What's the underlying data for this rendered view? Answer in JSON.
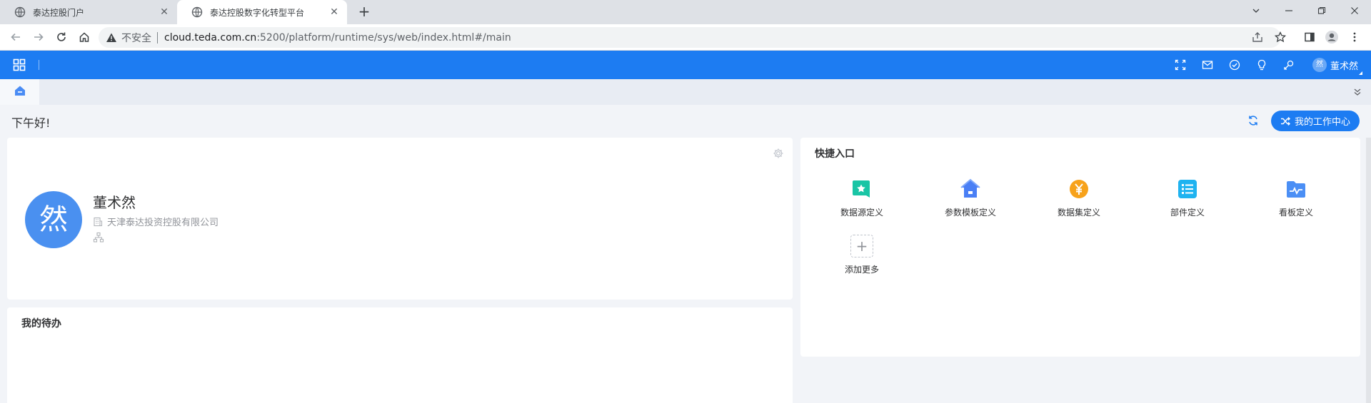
{
  "browser": {
    "tabs": [
      {
        "title": "泰达控股门户",
        "active": false
      },
      {
        "title": "泰达控股数字化转型平台",
        "active": true
      }
    ],
    "new_tab_label": "+",
    "close_glyph": "✕",
    "address": {
      "security_label": "不安全",
      "host": "cloud.teda.com.cn",
      "rest": ":5200/platform/runtime/sys/web/index.html#/main"
    }
  },
  "header": {
    "user_name": "董术然",
    "user_avatar_char": "然",
    "icons": [
      "fullscreen-icon",
      "mail-icon",
      "check-circle-icon",
      "lightbulb-icon",
      "pin-icon"
    ],
    "accent_color": "#1d7cf2"
  },
  "main": {
    "greeting": "下午好!",
    "work_center_button": "我的工作中心",
    "profile": {
      "avatar_char": "然",
      "name": "董术然",
      "org": "天津泰达投资控股有限公司"
    },
    "todo": {
      "title": "我的待办"
    },
    "quick": {
      "title": "快捷入口",
      "items": [
        {
          "label": "数据源定义",
          "icon": "star-folder-icon",
          "color": "#19c5a5"
        },
        {
          "label": "参数模板定义",
          "icon": "home-icon",
          "color": "#4a7ff5"
        },
        {
          "label": "数据集定义",
          "icon": "yen-coin-icon",
          "color": "#f7a21b"
        },
        {
          "label": "部件定义",
          "icon": "list-icon",
          "color": "#1fb3f0"
        },
        {
          "label": "看板定义",
          "icon": "chart-folder-icon",
          "color": "#4b8ff5"
        }
      ],
      "add_more": {
        "label": "添加更多",
        "glyph": "+"
      }
    }
  }
}
